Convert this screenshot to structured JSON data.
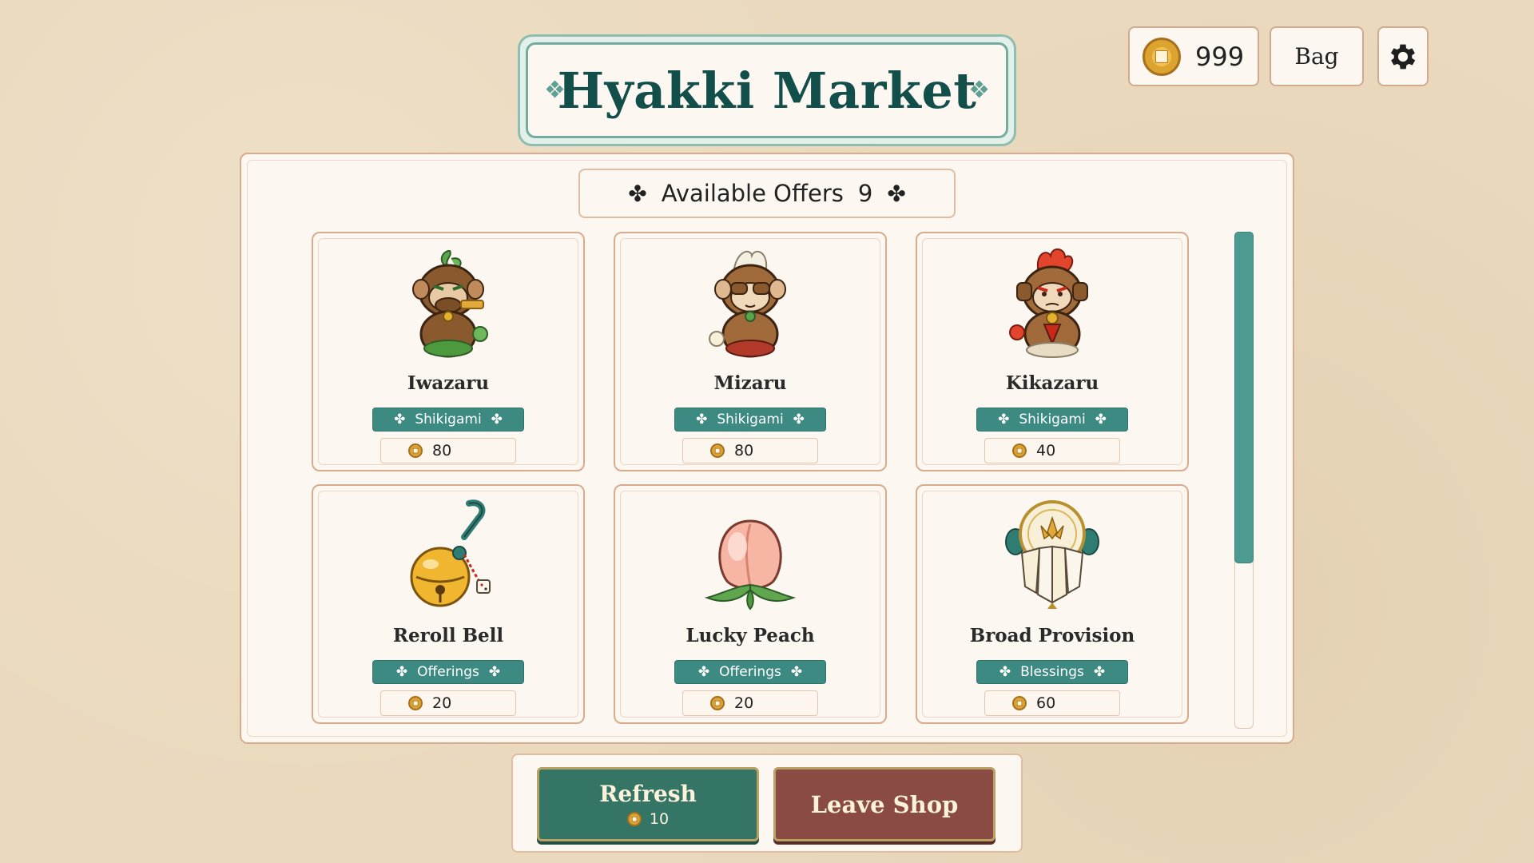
{
  "title": "Hyakki Market",
  "currency": {
    "amount": "999",
    "icon": "coin-icon"
  },
  "toolbar": {
    "bag_label": "Bag",
    "settings_icon": "gear-icon"
  },
  "offers": {
    "label": "Available Offers",
    "count": "9",
    "items": [
      {
        "name": "Iwazaru",
        "category": "Shikigami",
        "price": "80",
        "icon": "monkey-speak-no-evil-icon"
      },
      {
        "name": "Mizaru",
        "category": "Shikigami",
        "price": "80",
        "icon": "monkey-see-no-evil-icon"
      },
      {
        "name": "Kikazaru",
        "category": "Shikigami",
        "price": "40",
        "icon": "monkey-hear-no-evil-icon"
      },
      {
        "name": "Reroll Bell",
        "category": "Offerings",
        "price": "20",
        "icon": "bell-icon"
      },
      {
        "name": "Lucky Peach",
        "category": "Offerings",
        "price": "20",
        "icon": "peach-icon"
      },
      {
        "name": "Broad Provision",
        "category": "Blessings",
        "price": "60",
        "icon": "fan-emblem-icon"
      }
    ]
  },
  "scroll": {
    "position_fraction": 0,
    "visible_fraction": 0.67
  },
  "actions": {
    "refresh_label": "Refresh",
    "refresh_cost": "10",
    "leave_label": "Leave Shop"
  },
  "colors": {
    "accent_teal": "#3d8a83",
    "title_teal": "#134f4a",
    "refresh_green": "#347565",
    "leave_red": "#8b4b45",
    "background": "#ead9bd"
  }
}
